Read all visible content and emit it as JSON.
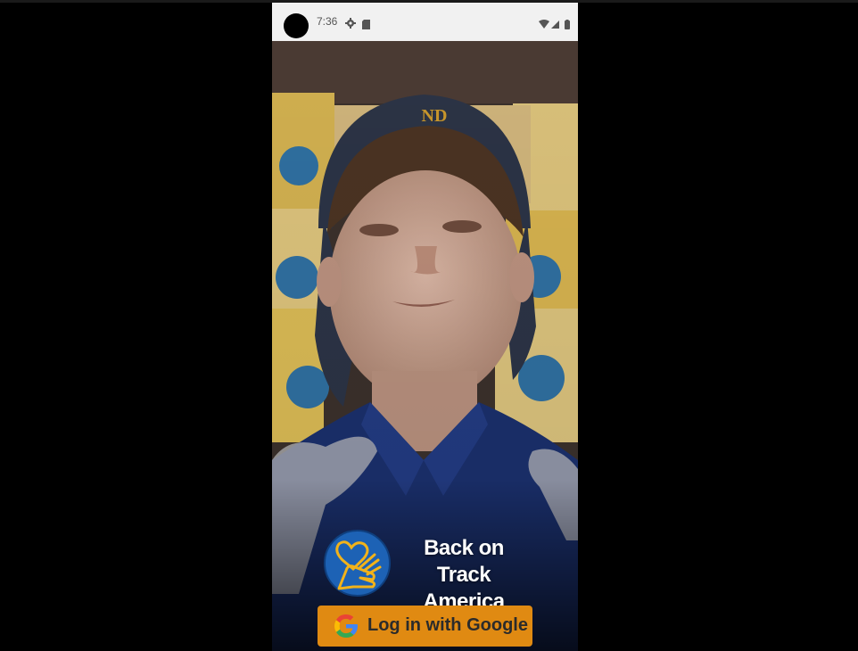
{
  "status_bar": {
    "time": "7:36",
    "icons": [
      "settings-icon",
      "sd-card-icon",
      "wifi-icon",
      "signal-icon",
      "battery-icon"
    ]
  },
  "background": {
    "description_colors": {
      "boxes": "#d2b24a",
      "shirt": "#1a2f6b",
      "cap": "#2b3345",
      "skin": "#c9a08e"
    },
    "cap_text": "ND"
  },
  "brand": {
    "logo_icon": "hand-heart-icon",
    "name_line1": "Back on Track",
    "name_line2": "America"
  },
  "login": {
    "label": "Log in with Google",
    "icon": "google-g-icon",
    "color": "#e08a12"
  }
}
